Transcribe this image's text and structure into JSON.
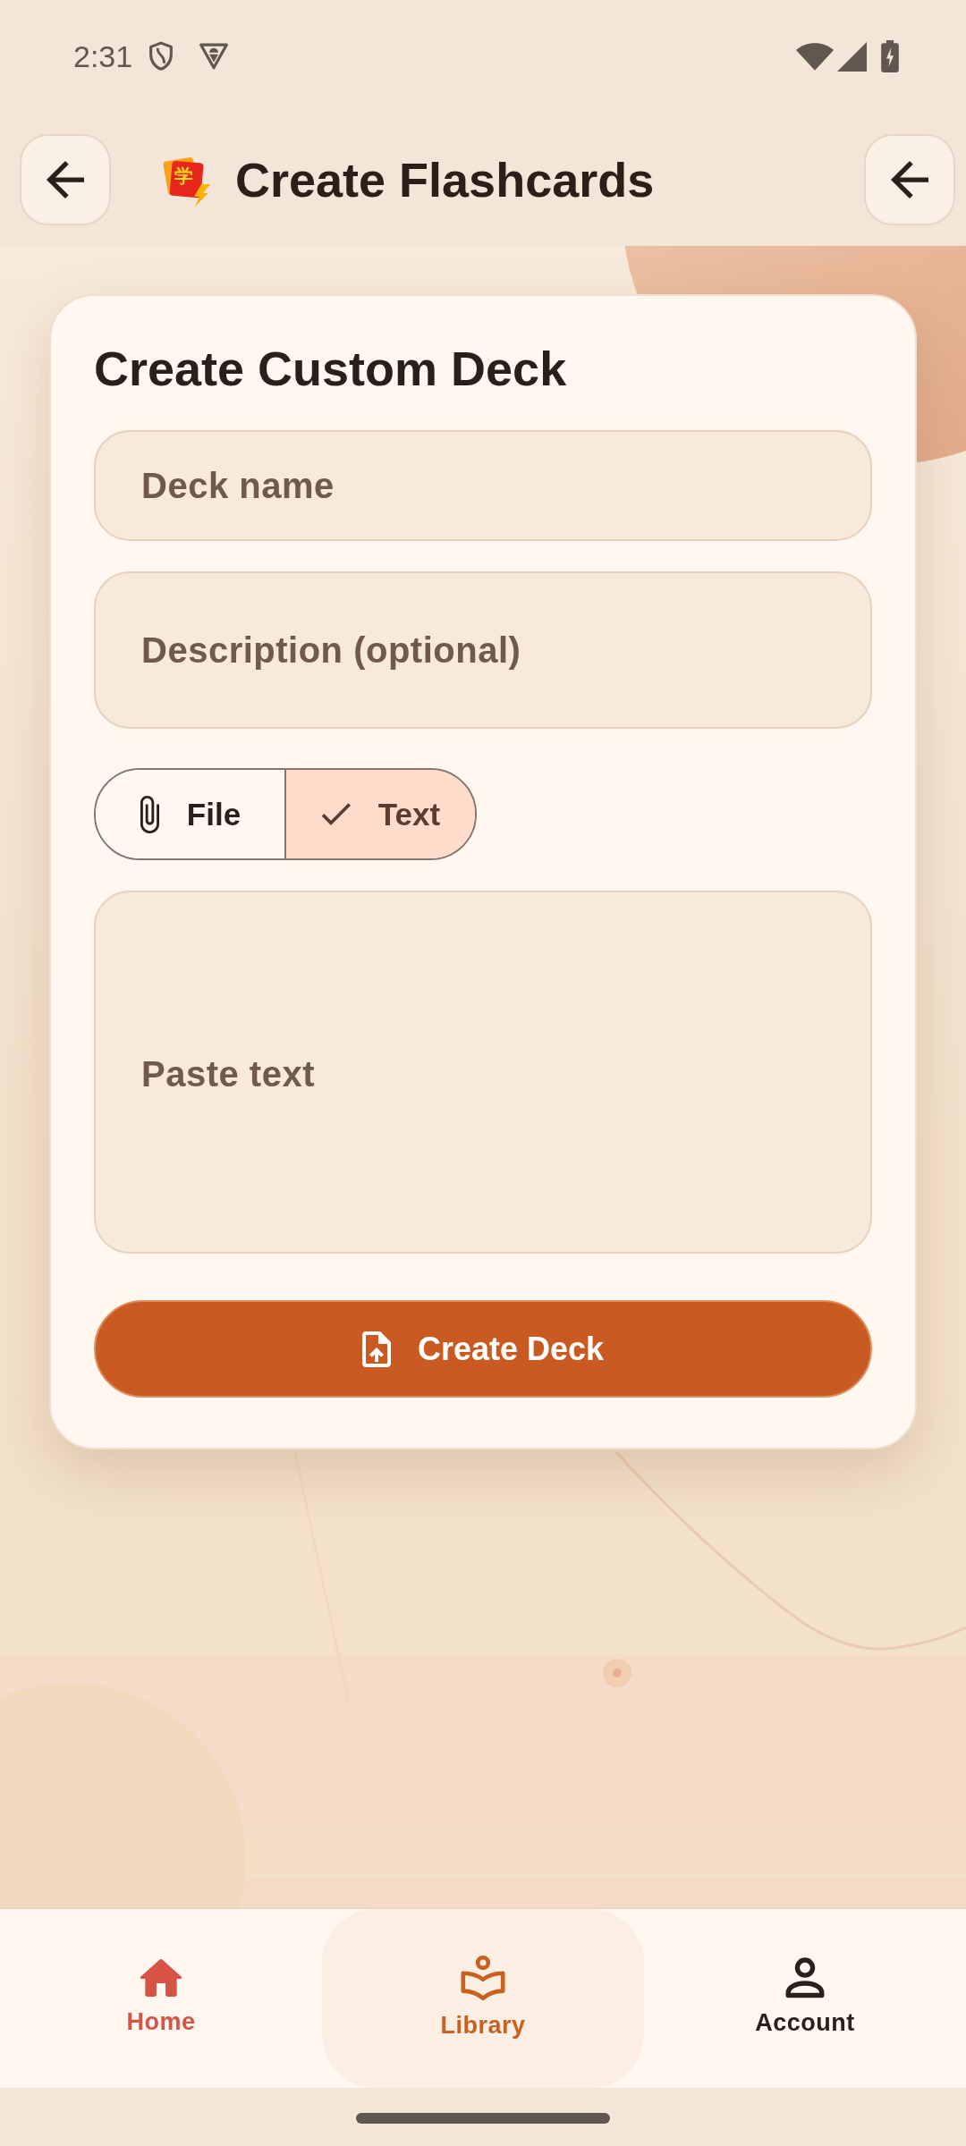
{
  "status_bar": {
    "time": "2:31"
  },
  "header": {
    "logo_character": "学",
    "title": "Create Flashcards"
  },
  "form": {
    "title": "Create Custom Deck",
    "deck_name": {
      "placeholder": "Deck name"
    },
    "description": {
      "placeholder": "Description (optional)"
    },
    "source_toggle": [
      {
        "label": "File",
        "selected": false
      },
      {
        "label": "Text",
        "selected": true
      }
    ],
    "paste_text": {
      "placeholder": "Paste text"
    },
    "submit_button": {
      "label": "Create Deck"
    }
  },
  "bottom_nav": [
    {
      "label": "Home",
      "selected": false,
      "color": "#d65345"
    },
    {
      "label": "Library",
      "selected": true,
      "color": "#c8601f"
    },
    {
      "label": "Account",
      "selected": false,
      "color": "#2b211c"
    }
  ]
}
